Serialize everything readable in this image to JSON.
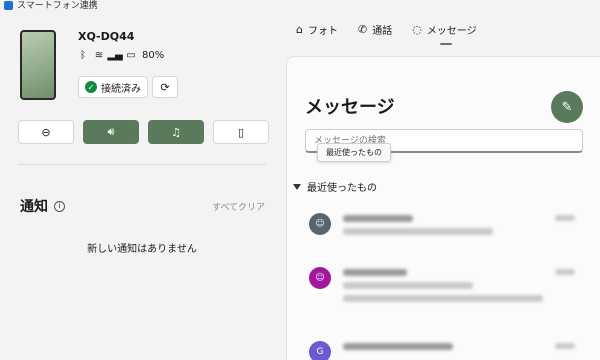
{
  "app": {
    "title": "スマートフォン連携"
  },
  "device": {
    "name": "XQ-DQ44",
    "battery": "80%",
    "connection_label": "接続済み"
  },
  "quick_actions": [
    {
      "icon": "do-not-disturb-icon",
      "glyph": "⊖",
      "active": false
    },
    {
      "icon": "volume-icon",
      "glyph": "🔊︎",
      "active": true
    },
    {
      "icon": "music-icon",
      "glyph": "♫",
      "active": true
    },
    {
      "icon": "phone-audio-icon",
      "glyph": "▯",
      "active": false
    }
  ],
  "notifications": {
    "title": "通知",
    "clear_all": "すべてクリア",
    "empty_text": "新しい通知はありません"
  },
  "tabs": [
    {
      "label": "フォト",
      "icon": "photo-icon",
      "glyph": "⌂"
    },
    {
      "label": "通話",
      "icon": "phone-icon",
      "glyph": "✆"
    },
    {
      "label": "メッセージ",
      "icon": "message-icon",
      "glyph": "◌"
    }
  ],
  "messages": {
    "title": "メッセージ",
    "search_placeholder": "メッセージの検索",
    "tooltip": "最近使ったもの",
    "section_label": "最近使ったもの",
    "conversations": [
      {
        "avatar_letter": "",
        "avatar_color": "#5b6470"
      },
      {
        "avatar_letter": "",
        "avatar_color": "#a3179e"
      },
      {
        "avatar_letter": "G",
        "avatar_color": "#6a5bd1"
      }
    ]
  },
  "colors": {
    "accent": "#5a7a5c",
    "connected": "#118a3e"
  }
}
